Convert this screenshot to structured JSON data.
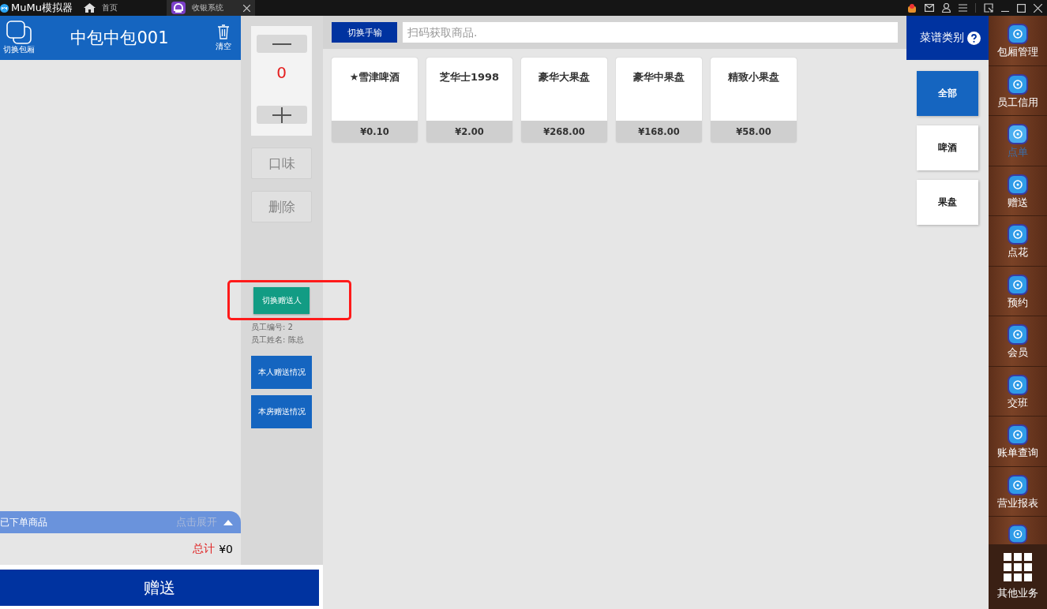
{
  "titlebar": {
    "app_name": "MuMu模拟器",
    "tabs": [
      {
        "kind": "home",
        "label": "首页",
        "selected": false
      },
      {
        "kind": "app",
        "label": "收银系统",
        "selected": true
      }
    ]
  },
  "room": {
    "switch_label": "切换包厢",
    "name": "中包中包001",
    "clear_label": "清空"
  },
  "ordered": {
    "title": "已下单商品",
    "toggle": "点击展开",
    "total_label": "总计",
    "total": "¥0"
  },
  "submit_button": "赠送",
  "quantity": {
    "value": "0"
  },
  "actions": [
    "口味",
    "删除"
  ],
  "giver": {
    "switch_button": "切换赠送人",
    "highlighted": true,
    "employee_no": "员工编号: 2",
    "employee_name": "员工姓名: 陈总"
  },
  "reports": [
    "本人赠送情况",
    "本房赠送情况"
  ],
  "scan": {
    "mode_button": "切换手输",
    "placeholder": "扫码获取商品."
  },
  "products": [
    {
      "name": "★雪津啤酒",
      "price": "¥0.10"
    },
    {
      "name": "芝华士1998",
      "price": "¥2.00"
    },
    {
      "name": "豪华大果盘",
      "price": "¥268.00"
    },
    {
      "name": "豪华中果盘",
      "price": "¥168.00"
    },
    {
      "name": "精致小果盘",
      "price": "¥58.00"
    }
  ],
  "categories": {
    "title": "菜谱类别",
    "items": [
      {
        "label": "全部",
        "selected": true
      },
      {
        "label": "啤酒",
        "selected": false
      },
      {
        "label": "果盘",
        "selected": false
      }
    ]
  },
  "nav": {
    "items": [
      {
        "label": "包厢管理",
        "selected": false
      },
      {
        "label": "员工信用",
        "selected": false
      },
      {
        "label": "点单",
        "selected": true
      },
      {
        "label": "赠送",
        "selected": false
      },
      {
        "label": "点花",
        "selected": false
      },
      {
        "label": "预约",
        "selected": false
      },
      {
        "label": "会员",
        "selected": false
      },
      {
        "label": "交班",
        "selected": false
      },
      {
        "label": "账单查询",
        "selected": false
      },
      {
        "label": "营业报表",
        "selected": false
      },
      {
        "selected": false
      }
    ],
    "more": "其他业务"
  }
}
